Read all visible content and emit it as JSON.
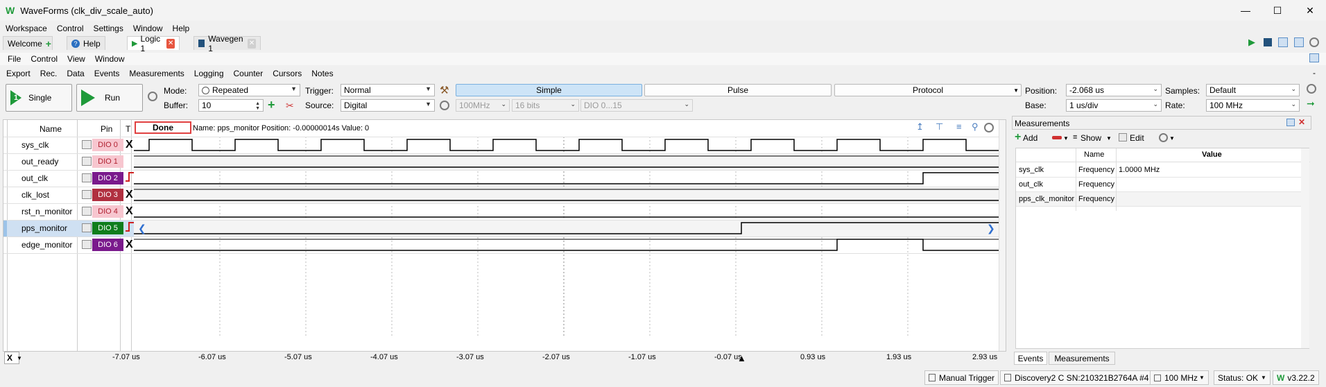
{
  "window": {
    "title": "WaveForms (clk_div_scale_auto)"
  },
  "main_menu": [
    "Workspace",
    "Control",
    "Settings",
    "Window",
    "Help"
  ],
  "tabs": [
    {
      "label": "Welcome"
    },
    {
      "label": "Help"
    },
    {
      "label": "Logic 1"
    },
    {
      "label": "Wavegen 1"
    }
  ],
  "logic_menu": [
    "File",
    "Control",
    "View",
    "Window"
  ],
  "toolbar_menu": [
    "Export",
    "Rec.",
    "Data",
    "Events",
    "Measurements",
    "Logging",
    "Counter",
    "Cursors",
    "Notes"
  ],
  "acquire": {
    "single_label": "Single",
    "run_label": "Run",
    "mode_label": "Mode:",
    "mode_value": "Repeated",
    "buffer_label": "Buffer:",
    "buffer_value": "10",
    "trigger_label": "Trigger:",
    "trigger_value": "Normal",
    "source_label": "Source:",
    "source_value": "Digital",
    "rate_value": "100MHz",
    "bits_value": "16 bits",
    "dio_range": "DIO 0...15",
    "tab_simple": "Simple",
    "tab_pulse": "Pulse",
    "tab_protocol": "Protocol",
    "position_label": "Position:",
    "position_value": "-2.068 us",
    "base_label": "Base:",
    "base_value": "1 us/div",
    "samples_label": "Samples:",
    "samples_value": "Default",
    "rate_label": "Rate:",
    "rate_value2": "100 MHz"
  },
  "grid": {
    "col_name": "Name",
    "col_pin": "Pin",
    "col_t": "T",
    "status": "Done",
    "info": "Name: pps_monitor  Position: -0.00000014s  Value: 0"
  },
  "signals": [
    {
      "name": "sys_clk",
      "pin": "DIO 0",
      "color": "#f7c6cf",
      "textcolor": "#b02030",
      "trigger": "X"
    },
    {
      "name": "out_ready",
      "pin": "DIO 1",
      "color": "#f7c6cf",
      "textcolor": "#b02030",
      "trigger": ""
    },
    {
      "name": "out_clk",
      "pin": "DIO 2",
      "color": "#7a1a8c",
      "textcolor": "#ffffff",
      "trigger": "rise"
    },
    {
      "name": "clk_lost",
      "pin": "DIO 3",
      "color": "#b03040",
      "textcolor": "#ffffff",
      "trigger": "X"
    },
    {
      "name": "rst_n_monitor",
      "pin": "DIO 4",
      "color": "#f7c6cf",
      "textcolor": "#b02030",
      "trigger": "X"
    },
    {
      "name": "pps_monitor",
      "pin": "DIO 5",
      "color": "#0f7d1c",
      "textcolor": "#ffffff",
      "trigger": "rise"
    },
    {
      "name": "edge_monitor",
      "pin": "DIO 6",
      "color": "#7a1a8c",
      "textcolor": "#ffffff",
      "trigger": "X"
    }
  ],
  "time_axis": [
    "-7.07 us",
    "-6.07 us",
    "-5.07 us",
    "-4.07 us",
    "-3.07 us",
    "-2.07 us",
    "-1.07 us",
    "-0.07 us",
    "0.93 us",
    "1.93 us",
    "2.93 us"
  ],
  "x_label": "X",
  "measurements": {
    "title": "Measurements",
    "add": "Add",
    "show": "Show",
    "edit": "Edit",
    "col_name": "Name",
    "col_value": "Value",
    "rows": [
      {
        "signal": "sys_clk",
        "name": "Frequency",
        "value": "1.0000 MHz"
      },
      {
        "signal": "out_clk",
        "name": "Frequency",
        "value": ""
      },
      {
        "signal": "pps_clk_monitor",
        "name": "Frequency",
        "value": ""
      }
    ],
    "bottom_tabs": [
      "Events",
      "Measurements"
    ]
  },
  "statusbar": {
    "manual_trigger": "Manual Trigger",
    "device": "Discovery2 C SN:210321B2764A #4",
    "clock": "100 MHz",
    "status": "Status: OK",
    "version": "v3.22.2"
  },
  "colors": {
    "accent": "#1f9a3a",
    "selected": "#cde4f7"
  }
}
